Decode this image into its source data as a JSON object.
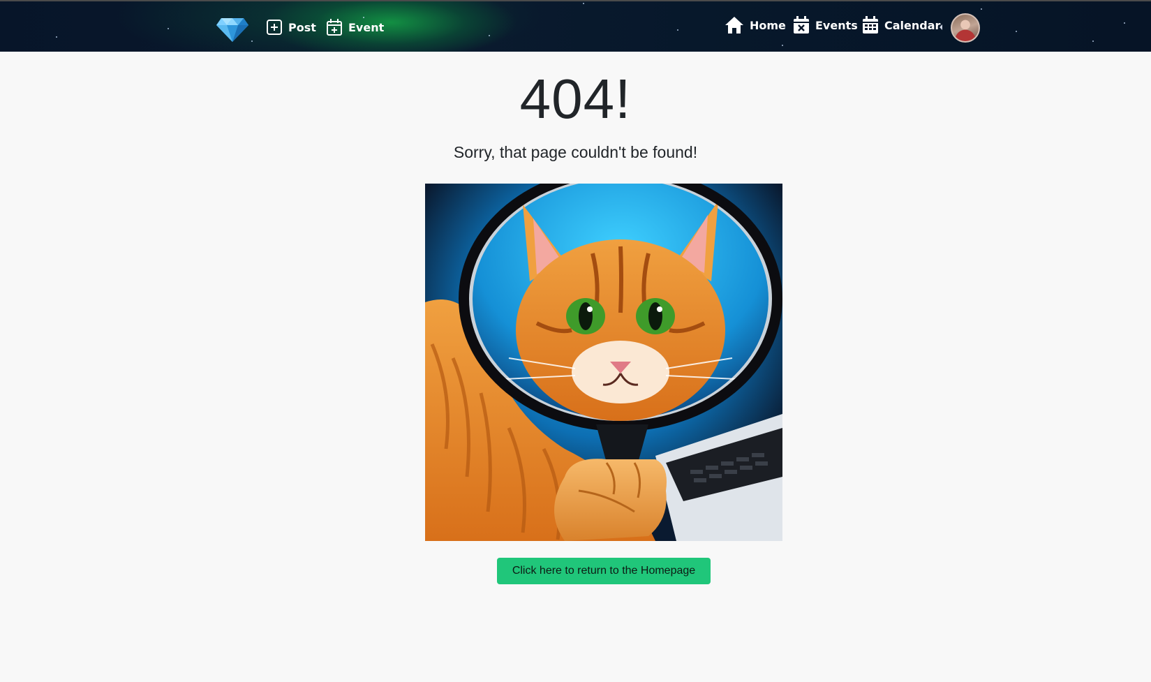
{
  "nav": {
    "brand_icon": "diamond-icon",
    "left_items": [
      {
        "label": "Post",
        "icon": "plus-square-icon"
      },
      {
        "label": "Event",
        "icon": "calendar-plus-icon"
      }
    ],
    "right_items": [
      {
        "label": "Home",
        "icon": "house-icon"
      },
      {
        "label": "Events",
        "icon": "calendar-x-icon"
      },
      {
        "label": "Calendar",
        "icon": "calendar-grid-icon"
      }
    ]
  },
  "main": {
    "title": "404!",
    "subtitle": "Sorry, that page couldn't be found!",
    "image_subject": "orange cat looking through a magnifying glass",
    "button_label": "Click here to return to the Homepage"
  },
  "colors": {
    "nav_bg": "#071529",
    "page_bg": "#f8f8f8",
    "button_bg": "#20c67a",
    "text": "#212529"
  }
}
